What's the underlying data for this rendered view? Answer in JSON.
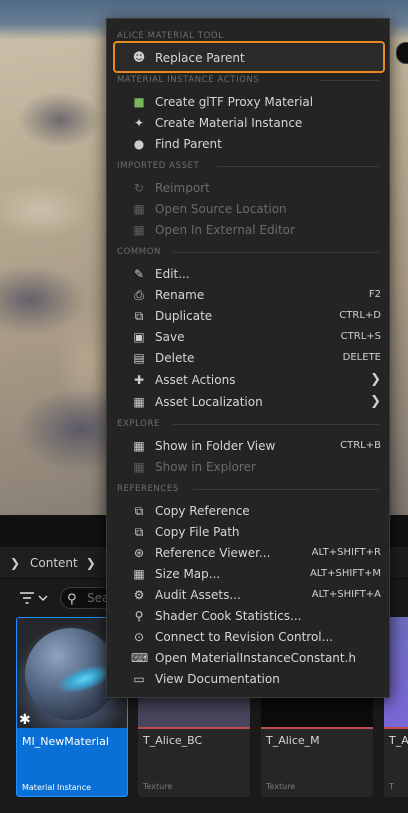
{
  "menu": {
    "sections": {
      "alice": "ALICE MATERIAL TOOL",
      "mi_actions": "MATERIAL INSTANCE ACTIONS",
      "imported": "IMPORTED ASSET",
      "common": "COMMON",
      "explore": "EXPLORE",
      "references": "REFERENCES"
    },
    "items": {
      "replace_parent": "Replace Parent",
      "create_gltf": "Create glTF Proxy Material",
      "create_mi": "Create Material Instance",
      "find_parent": "Find Parent",
      "reimport": "Reimport",
      "open_source": "Open Source Location",
      "open_external": "Open In External Editor",
      "edit": "Edit...",
      "rename": "Rename",
      "duplicate": "Duplicate",
      "save": "Save",
      "delete": "Delete",
      "asset_actions": "Asset Actions",
      "asset_localization": "Asset Localization",
      "show_folder": "Show in Folder View",
      "show_explorer": "Show in Explorer",
      "copy_reference": "Copy Reference",
      "copy_file_path": "Copy File Path",
      "reference_viewer": "Reference Viewer...",
      "size_map": "Size Map...",
      "audit_assets": "Audit Assets...",
      "shader_cook": "Shader Cook Statistics...",
      "connect_rc": "Connect to Revision Control...",
      "open_mic": "Open MaterialInstanceConstant.h",
      "view_docs": "View Documentation"
    },
    "shortcuts": {
      "rename": "F2",
      "duplicate": "CTRL+D",
      "save": "CTRL+S",
      "delete": "DELETE",
      "show_folder": "CTRL+B",
      "reference_viewer": "ALT+SHIFT+R",
      "size_map": "ALT+SHIFT+M",
      "audit_assets": "ALT+SHIFT+A"
    },
    "highlight_color": "#ea8a1e"
  },
  "content_browser": {
    "breadcrumb": "Content",
    "search_placeholder": "Sea",
    "assets": [
      {
        "name": "MI_NewMaterial",
        "type": "Material Instance",
        "selected": true
      },
      {
        "name": "T_Alice_BC",
        "type": "Texture"
      },
      {
        "name": "T_Alice_M",
        "type": "Texture"
      },
      {
        "name": "T_A",
        "type": "T"
      }
    ]
  }
}
